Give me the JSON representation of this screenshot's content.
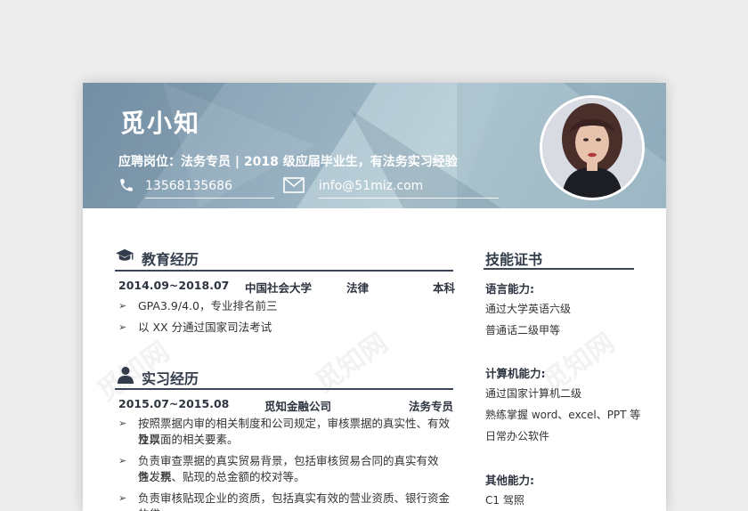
{
  "header": {
    "name": "觅小知",
    "job_line": "应聘岗位：法务专员 | 2018 级应届毕业生，有法务实习经验",
    "phone": "13568135686",
    "email": "info@51miz.com"
  },
  "education": {
    "title": "教育经历",
    "date": "2014.09~2018.07",
    "school": "中国社会大学",
    "major": "法律",
    "degree": "本科",
    "items": [
      "GPA3.9/4.0，专业排名前三",
      "以 XX 分通过国家司法考试"
    ]
  },
  "internship": {
    "title": "实习经历",
    "date": "2015.07~2015.08",
    "company": "觅知金融公司",
    "role": "法务专员",
    "items": [
      [
        "按照票据内审的相关制度和公司规定，审核票据的真实性、有效性以",
        "及票面的相关要素。"
      ],
      [
        "负责审查票据的真实贸易背景，包括审核贸易合同的真实有效性、税",
        "务发票、贴现的总金额的校对等。"
      ],
      [
        "负责审核贴现企业的资质，包括真实有效的营业资质、银行资金的贷"
      ]
    ]
  },
  "skills": {
    "title": "技能证书",
    "groups": [
      {
        "heading": "语言能力:",
        "items": [
          "通过大学英语六级",
          "普通话二级甲等"
        ]
      },
      {
        "heading": "计算机能力:",
        "items": [
          "通过国家计算机二级",
          "熟练掌握 word、excel、PPT 等",
          "日常办公软件"
        ]
      },
      {
        "heading": "其他能力:",
        "items": [
          "C1 驾照"
        ]
      }
    ]
  },
  "watermark": "觅知网",
  "colors": {
    "accent": "#3b4656",
    "header": "#9fb6c6"
  }
}
